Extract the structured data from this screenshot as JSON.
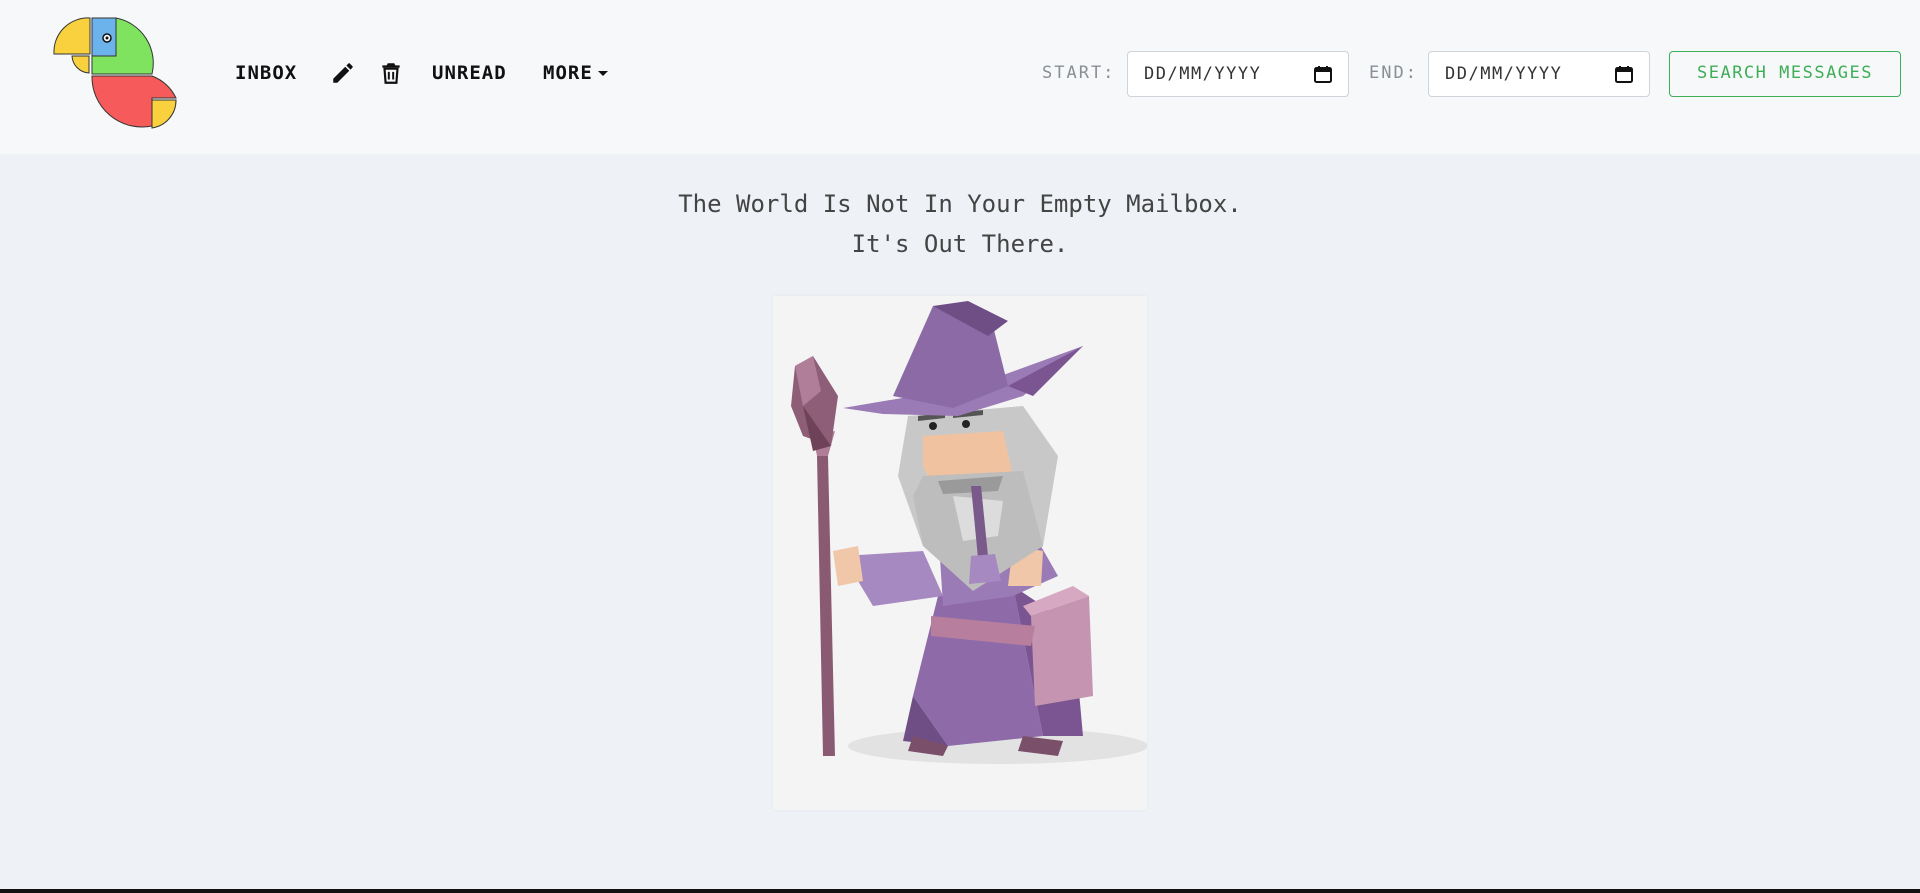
{
  "nav": {
    "inbox": "Inbox",
    "compose_icon": "pencil-icon",
    "delete_icon": "trash-icon",
    "unread": "Unread",
    "more": "More"
  },
  "filters": {
    "start_label": "START:",
    "start_placeholder": "DD/MM/YYYY",
    "end_label": "END:",
    "end_placeholder": "DD/MM/YYYY",
    "calendar_icon": "calendar-icon"
  },
  "search_button": "SEARCH MESSAGES",
  "empty_state": {
    "line1": "The World Is Not In Your Empty Mailbox.",
    "line2": "It's Out There."
  },
  "colors": {
    "accent": "#3fae57",
    "logo_yellow": "#f9d13e",
    "logo_blue": "#6cb2eb",
    "logo_green": "#7fe35f",
    "logo_red": "#f75a5a",
    "wizard_purple": "#9a7ab3"
  }
}
